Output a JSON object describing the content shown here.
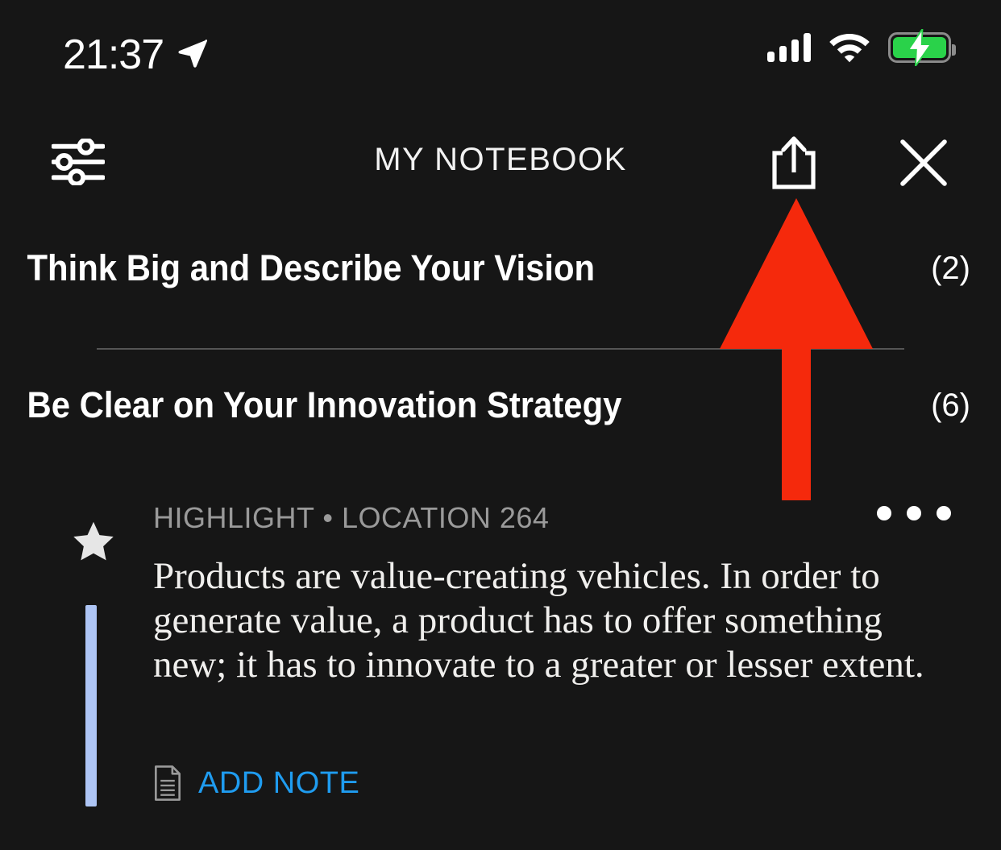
{
  "status_bar": {
    "time": "21:37",
    "location_icon": "location-arrow-icon",
    "signal_icon": "cellular-signal-icon",
    "signal_bars": 4,
    "wifi_icon": "wifi-icon",
    "battery_icon": "battery-charging-icon",
    "battery_color": "#2ad24a"
  },
  "header": {
    "title": "MY NOTEBOOK",
    "filter_icon": "filter-sliders-icon",
    "share_icon": "share-icon",
    "close_icon": "close-icon"
  },
  "chapters": [
    {
      "title": "Think Big and Describe Your Vision",
      "count": "(2)"
    },
    {
      "title": "Be Clear on Your Innovation Strategy",
      "count": "(6)"
    }
  ],
  "highlight": {
    "star_icon": "star-icon",
    "meta": "HIGHLIGHT • LOCATION 264",
    "type": "HIGHLIGHT",
    "location": "LOCATION 264",
    "more_icon": "more-options-icon",
    "text": "Products are value-creating vehicles. In order to generate value, a product has to offer something new; it has to innovate to a greater or lesser extent.",
    "accent_color": "#aec5f5",
    "add_note": {
      "label": "ADD NOTE",
      "icon": "note-document-icon",
      "color": "#1f9cf0"
    }
  },
  "annotation": {
    "arrow_icon": "red-up-arrow-annotation",
    "color": "#f5290c"
  }
}
